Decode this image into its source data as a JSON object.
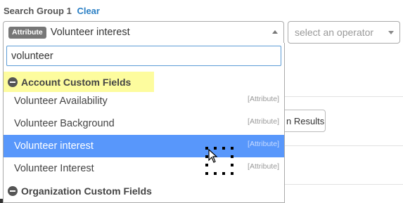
{
  "header": {
    "title": "Search Group 1",
    "clear_label": "Clear"
  },
  "attribute_select": {
    "badge": "Attribute",
    "value": "Volunteer interest"
  },
  "operator_select": {
    "placeholder": "select an operator"
  },
  "background": {
    "results_button_label": "n Results"
  },
  "dropdown": {
    "search_value": "volunteer",
    "groups": [
      {
        "label": "Account Custom Fields",
        "options": [
          {
            "label": "Volunteer Availability",
            "type": "[Attribute]"
          },
          {
            "label": "Volunteer Background",
            "type": "[Attribute]"
          },
          {
            "label": "Volunteer interest",
            "type": "[Attribute]",
            "highlighted": true
          },
          {
            "label": "Volunteer Interest",
            "type": "[Attribute]"
          }
        ]
      },
      {
        "label": "Organization Custom Fields",
        "options": []
      }
    ]
  },
  "colors": {
    "link": "#2a7fc4",
    "highlight_option": "#5897fb",
    "group_highlight": "#fdfc9e",
    "badge": "#777777"
  },
  "icons": [
    "minus-circle-icon",
    "caret-up-icon",
    "caret-down-icon",
    "cursor-icon"
  ]
}
